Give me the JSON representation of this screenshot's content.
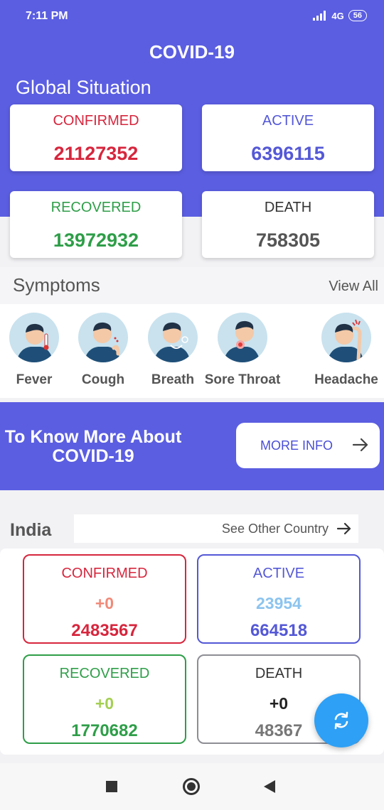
{
  "status_bar": {
    "time": "7:11 PM",
    "network": "4G",
    "battery": "56"
  },
  "app": {
    "title": "COVID-19"
  },
  "global": {
    "title": "Global Situation",
    "confirmed": {
      "label": "CONFIRMED",
      "value": "21127352",
      "color": "#d7263d"
    },
    "active": {
      "label": "ACTIVE",
      "value": "6396115",
      "color": "#5458d6"
    },
    "recovered": {
      "label": "RECOVERED",
      "value": "13972932",
      "color": "#2e9e48"
    },
    "death": {
      "label": "DEATH",
      "value": "758305",
      "color": "#555555"
    }
  },
  "symptoms": {
    "title": "Symptoms",
    "view_all": "View All",
    "items": [
      {
        "name": "Fever",
        "icon": "fever-icon"
      },
      {
        "name": "Cough",
        "icon": "cough-icon"
      },
      {
        "name": "Breath",
        "icon": "breath-icon"
      },
      {
        "name": "Sore Throat",
        "icon": "sore-throat-icon"
      },
      {
        "name": "Headache",
        "icon": "headache-icon"
      }
    ]
  },
  "banner": {
    "line1": "To Know More About",
    "line2": "COVID-19",
    "button": "MORE INFO"
  },
  "india": {
    "country": "India",
    "see_other": "See Other Country",
    "confirmed": {
      "label": "CONFIRMED",
      "delta": "+0",
      "value": "2483567"
    },
    "active": {
      "label": "ACTIVE",
      "delta": "23954",
      "value": "664518"
    },
    "recovered": {
      "label": "RECOVERED",
      "delta": "+0",
      "value": "1770682"
    },
    "death": {
      "label": "DEATH",
      "delta": "+0",
      "value": "48367"
    }
  },
  "colors": {
    "primary": "#5b5ee1",
    "fab": "#2ea0f5"
  }
}
